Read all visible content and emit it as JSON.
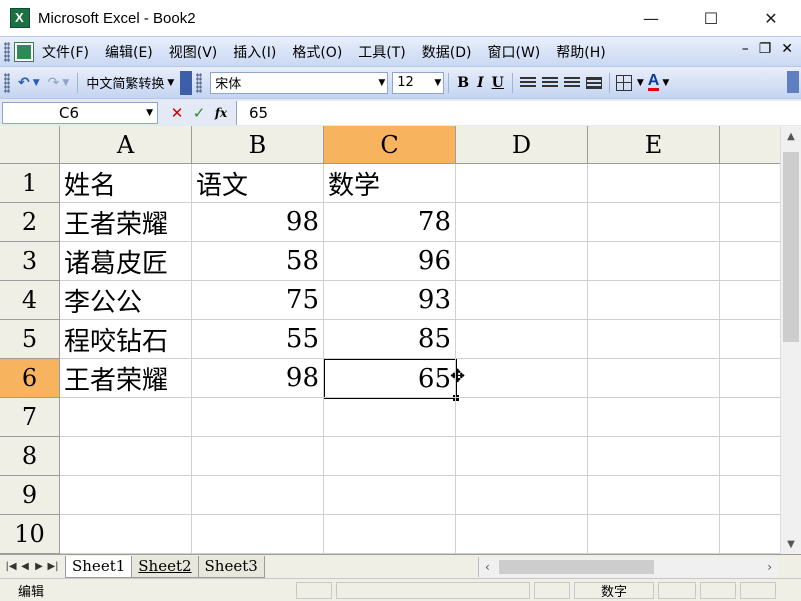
{
  "window": {
    "title": "Microsoft Excel - Book2",
    "minimize": "—",
    "maximize": "☐",
    "close": "✕"
  },
  "menu": {
    "items": [
      "文件(F)",
      "编辑(E)",
      "视图(V)",
      "插入(I)",
      "格式(O)",
      "工具(T)",
      "数据(D)",
      "窗口(W)",
      "帮助(H)"
    ],
    "doc_min": "–",
    "doc_restore": "❐",
    "doc_close": "✕"
  },
  "toolbar": {
    "undo": "↶",
    "redo": "↷",
    "convert_label": "中文简繁转换",
    "font_name": "宋体",
    "font_size": "12",
    "bold": "B",
    "italic": "I",
    "underline": "U",
    "font_color_glyph": "A"
  },
  "formula_bar": {
    "name_box": "C6",
    "cancel": "✕",
    "enter": "✓",
    "fx": "fx",
    "value": "65"
  },
  "sheet": {
    "columns": [
      "A",
      "B",
      "C",
      "D",
      "E"
    ],
    "rows": [
      "1",
      "2",
      "3",
      "4",
      "5",
      "6",
      "7",
      "8",
      "9",
      "10"
    ],
    "selected_column": "C",
    "selected_row": "6",
    "cells": {
      "A1": "姓名",
      "B1": "语文",
      "C1": "数学",
      "A2": "王者荣耀",
      "B2": "98",
      "C2": "78",
      "A3": "诸葛皮匠",
      "B3": "58",
      "C3": "96",
      "A4": "李公公",
      "B4": "75",
      "C4": "93",
      "A5": "程咬钻石",
      "B5": "55",
      "C5": "85",
      "A6": "王者荣耀",
      "B6": "98",
      "C6": "65"
    }
  },
  "tabs": {
    "items": [
      "Sheet1",
      "Sheet2",
      "Sheet3"
    ],
    "active": "Sheet1"
  },
  "status": {
    "mode": "编辑",
    "indicator": "数字"
  },
  "colors": {
    "selected_header": "#f8b35e",
    "toolbar_blue": "#c9d8f3",
    "excel_green": "#1d7044"
  }
}
